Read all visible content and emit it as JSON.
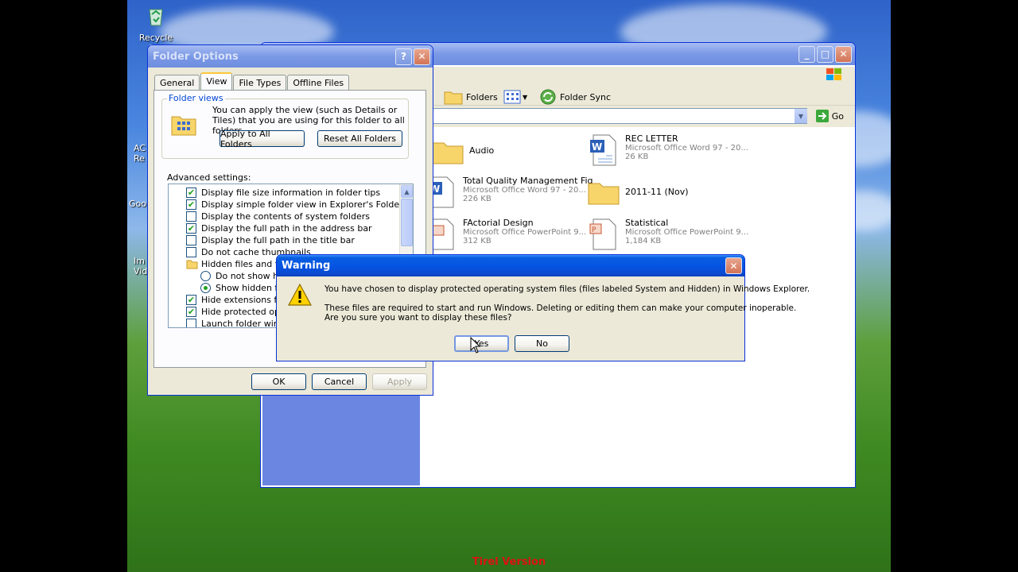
{
  "desktop": {
    "recycle_bin_label": "Recycle Bin",
    "partial_labels": [
      "AC",
      "Re",
      "Goo",
      "Im",
      "Vid"
    ]
  },
  "explorer": {
    "toolbar": {
      "folders_label": "Folders",
      "folder_sync_label": "Folder Sync",
      "go_label": "Go"
    },
    "files": [
      {
        "name": "Audio",
        "sub1": "",
        "sub2": "",
        "kind": "folder"
      },
      {
        "name": "REC LETTER",
        "sub1": "Microsoft Office Word 97 - 20...",
        "sub2": "26 KB",
        "kind": "word"
      },
      {
        "name": "Total Quality Management Fig",
        "sub1": "Microsoft Office Word 97 - 20...",
        "sub2": "226 KB",
        "kind": "word"
      },
      {
        "name": "2011-11 (Nov)",
        "sub1": "",
        "sub2": "",
        "kind": "folder"
      },
      {
        "name": "FActorial Design",
        "sub1": "Microsoft Office PowerPoint 9...",
        "sub2": "312 KB",
        "kind": "ppt"
      },
      {
        "name": "Statistical",
        "sub1": "Microsoft Office PowerPoint 9...",
        "sub2": "1,184 KB",
        "kind": "ppt"
      }
    ]
  },
  "folder_options": {
    "title": "Folder Options",
    "help_btn": "?",
    "tabs": [
      "General",
      "View",
      "File Types",
      "Offline Files"
    ],
    "folder_views_legend": "Folder views",
    "folder_views_text": "You can apply the view (such as Details or Tiles) that you are using for this folder to all folders.",
    "apply_all_label": "Apply to All Folders",
    "reset_all_label": "Reset All Folders",
    "advanced_label": "Advanced settings:",
    "advanced": [
      {
        "type": "check",
        "checked": true,
        "label": "Display file size information in folder tips"
      },
      {
        "type": "check",
        "checked": true,
        "label": "Display simple folder view in Explorer's Folders list"
      },
      {
        "type": "check",
        "checked": false,
        "label": "Display the contents of system folders"
      },
      {
        "type": "check",
        "checked": true,
        "label": "Display the full path in the address bar"
      },
      {
        "type": "check",
        "checked": false,
        "label": "Display the full path in the title bar"
      },
      {
        "type": "check",
        "checked": false,
        "label": "Do not cache thumbnails"
      },
      {
        "type": "folder",
        "label": "Hidden files and folde"
      },
      {
        "type": "radio",
        "checked": false,
        "label": "Do not show hidd"
      },
      {
        "type": "radio",
        "checked": true,
        "label": "Show hidden files"
      },
      {
        "type": "check",
        "checked": true,
        "label": "Hide extensions for kn"
      },
      {
        "type": "check",
        "checked": true,
        "label": "Hide protected operat"
      },
      {
        "type": "check",
        "checked": false,
        "label": "Launch folder window"
      }
    ],
    "ok_label": "OK",
    "cancel_label": "Cancel",
    "apply_label": "Apply"
  },
  "warning": {
    "title": "Warning",
    "line1": "You have chosen to display protected operating system files (files labeled System and Hidden) in Windows Explorer.",
    "line2": "These files are required to start and run Windows. Deleting or editing them can make your computer inoperable.",
    "line3": "Are you sure you want to display these files?",
    "yes_label": "Yes",
    "no_label": "No"
  },
  "watermark": "Tirel Version",
  "colors": {
    "title_active": "#0554e3",
    "checkmark": "#21a121",
    "legend_blue": "#0046d5"
  }
}
